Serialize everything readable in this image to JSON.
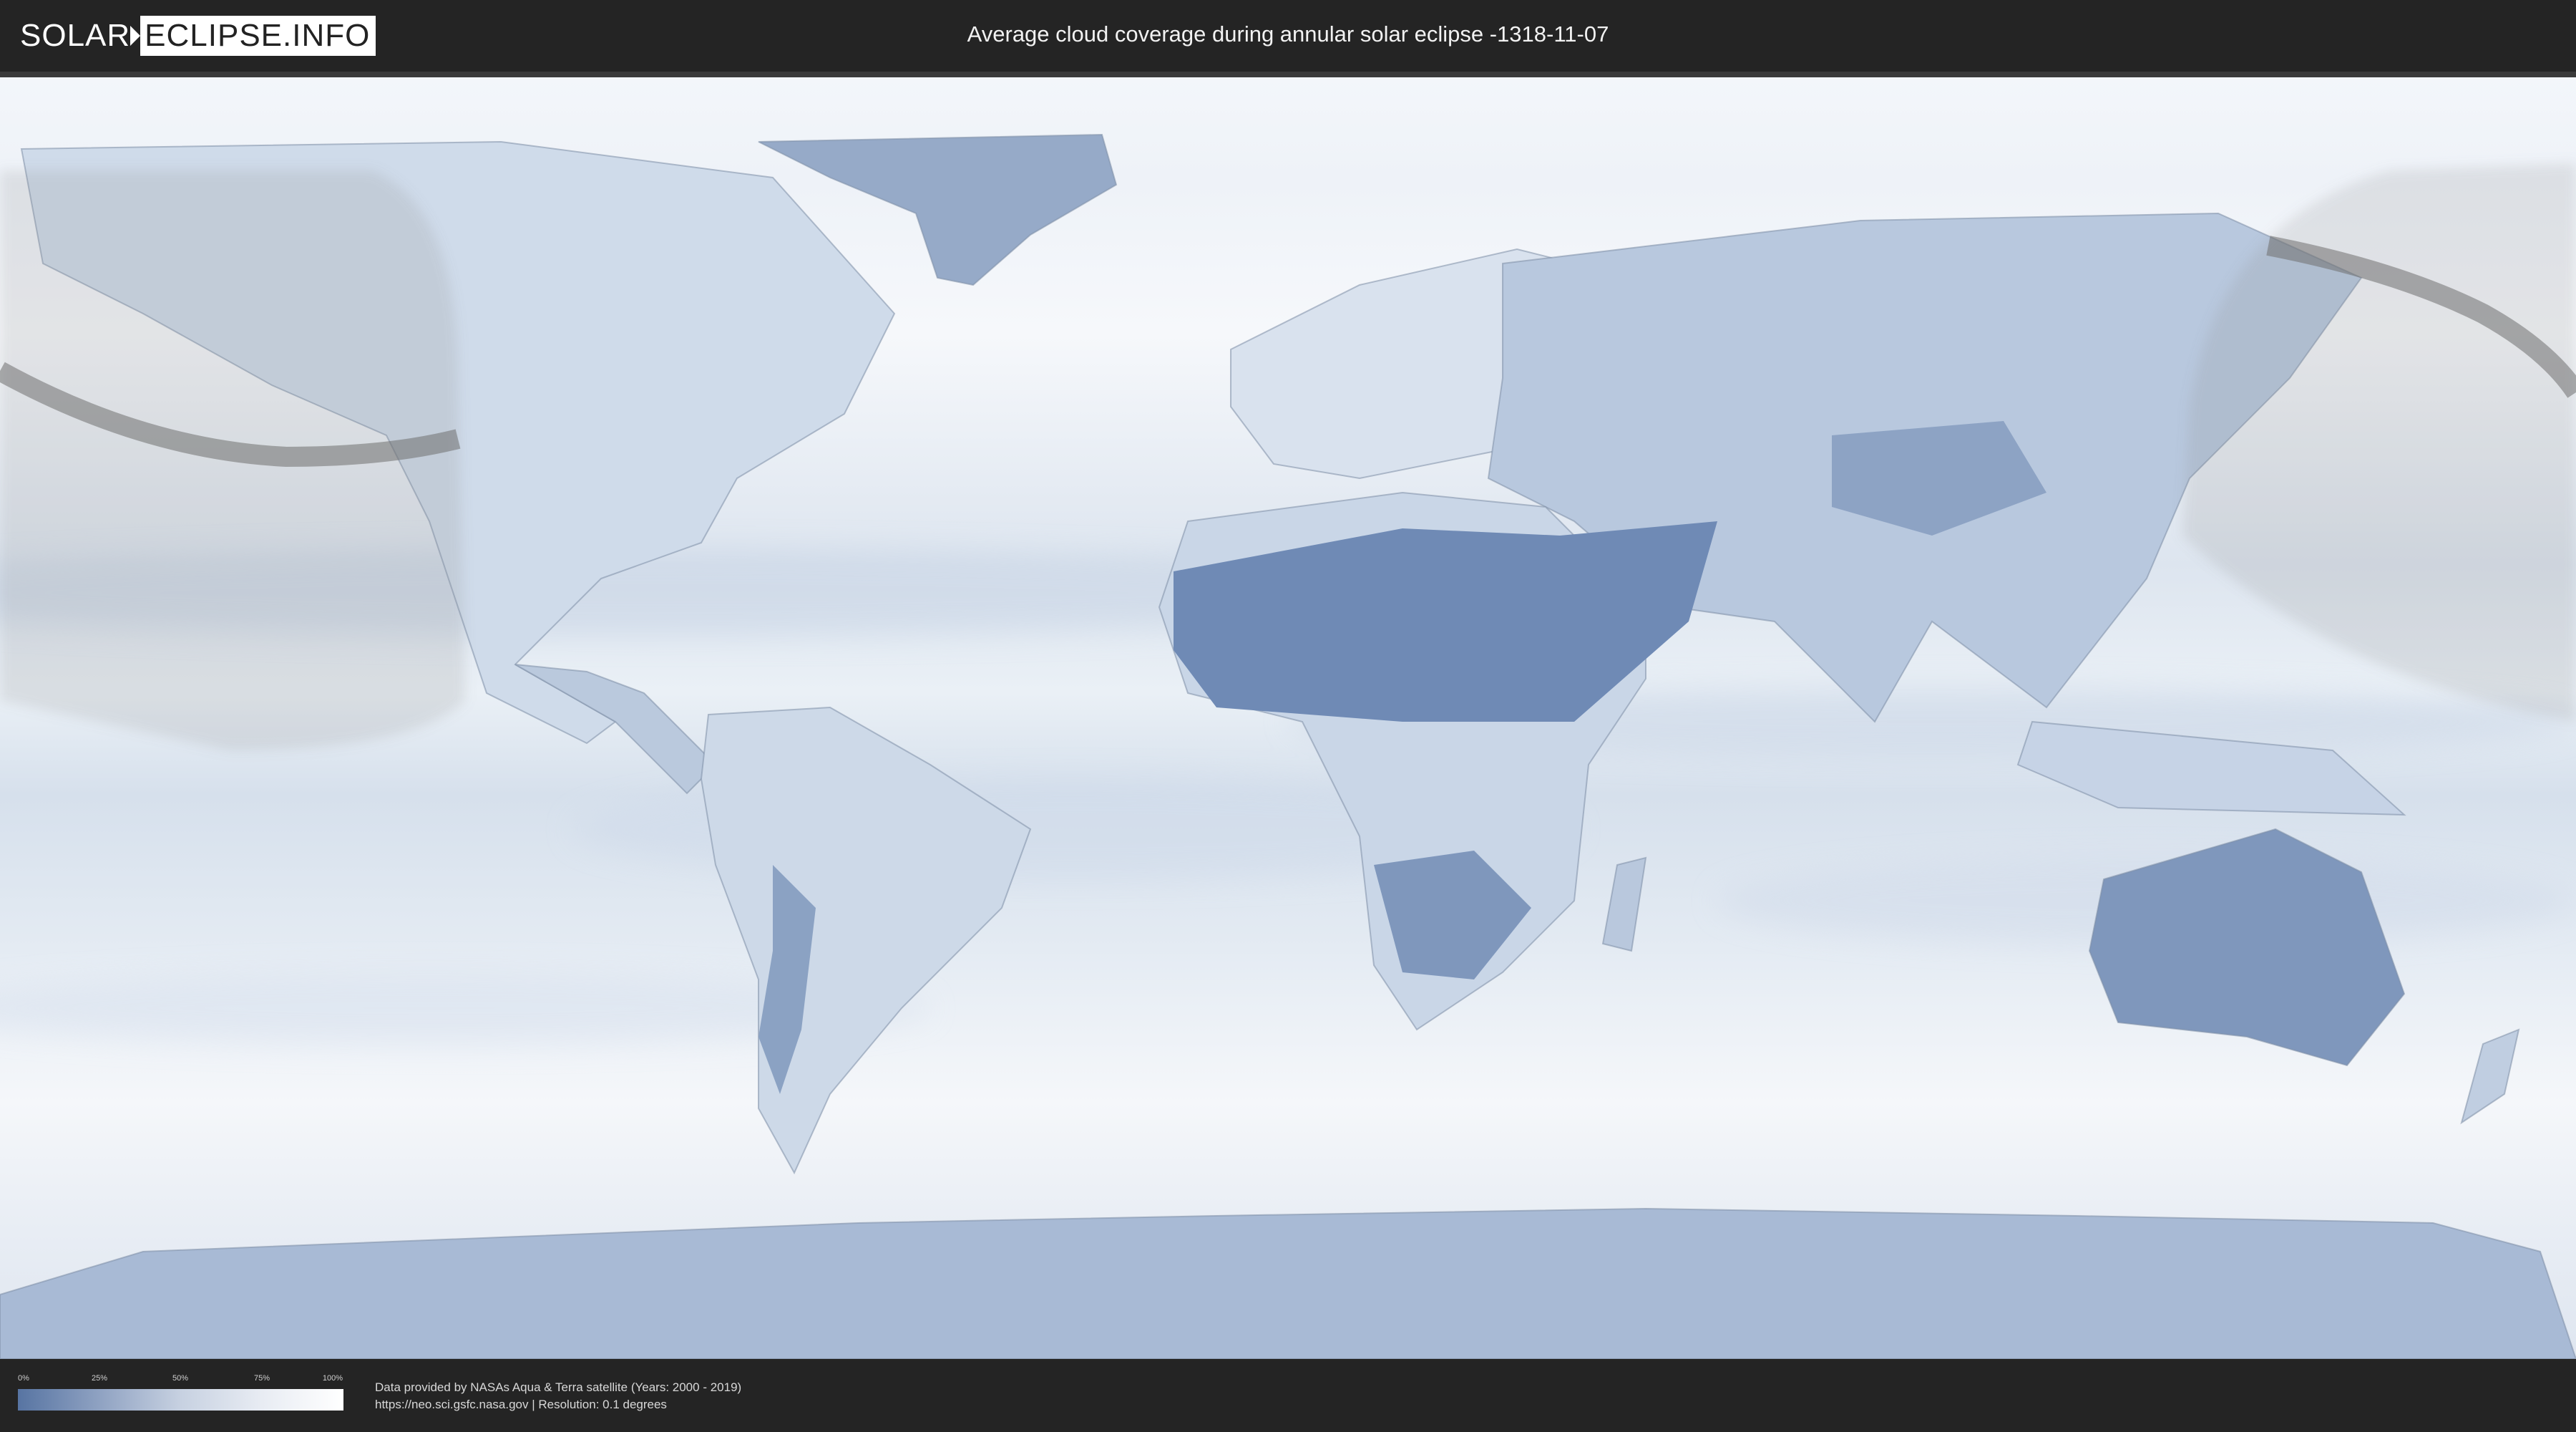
{
  "header": {
    "logo_left": "SOLAR",
    "logo_right": "ECLIPSE.INFO",
    "title": "Average cloud coverage during annular solar eclipse -1318-11-07"
  },
  "legend": {
    "ticks": [
      "0%",
      "25%",
      "50%",
      "75%",
      "100%"
    ],
    "color_low": "#5774a2",
    "color_high": "#ffffff"
  },
  "credits": {
    "line1": "Data provided by NASAs Aqua & Terra satellite (Years: 2000 - 2019)",
    "line2": "https://neo.sci.gsfc.nasa.gov | Resolution: 0.1 degrees"
  },
  "colors": {
    "ocean_cloud": "#e9eef5",
    "dry_land": "#6f8ab5",
    "header_bg": "#242424",
    "eclipse_shade": "#888888"
  }
}
